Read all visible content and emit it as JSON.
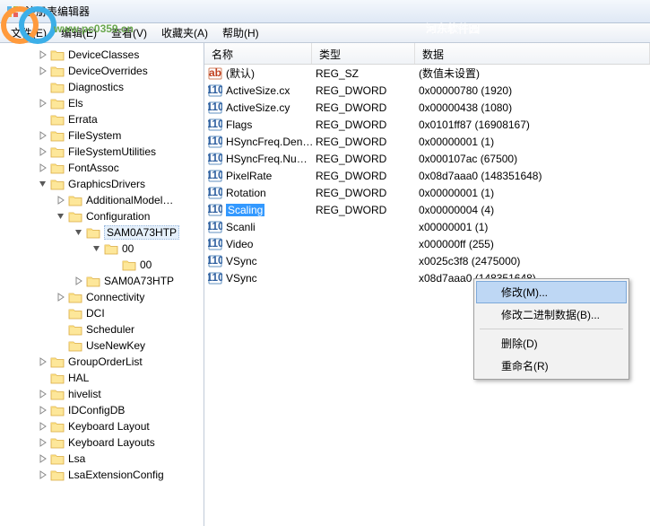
{
  "window": {
    "title": "注册表编辑器"
  },
  "menu": {
    "file": "文件(E)",
    "edit": "编辑(E)",
    "view": "查看(V)",
    "favorites": "收藏夹(A)",
    "help": "帮助(H)"
  },
  "watermark": {
    "url1": "www.pc0359.cn",
    "url2": "河东软件园"
  },
  "tree": [
    {
      "level": 1,
      "exp": "closed",
      "label": "DeviceClasses"
    },
    {
      "level": 1,
      "exp": "closed",
      "label": "DeviceOverrides"
    },
    {
      "level": 1,
      "exp": "none",
      "label": "Diagnostics"
    },
    {
      "level": 1,
      "exp": "closed",
      "label": "Els"
    },
    {
      "level": 1,
      "exp": "none",
      "label": "Errata"
    },
    {
      "level": 1,
      "exp": "closed",
      "label": "FileSystem"
    },
    {
      "level": 1,
      "exp": "closed",
      "label": "FileSystemUtilities"
    },
    {
      "level": 1,
      "exp": "closed",
      "label": "FontAssoc"
    },
    {
      "level": 1,
      "exp": "open",
      "label": "GraphicsDrivers"
    },
    {
      "level": 2,
      "exp": "closed",
      "label": "AdditionalModel…"
    },
    {
      "level": 2,
      "exp": "open",
      "label": "Configuration"
    },
    {
      "level": 3,
      "exp": "open",
      "label": "SAM0A73HTP",
      "highlight": true
    },
    {
      "level": 4,
      "exp": "open",
      "label": "00"
    },
    {
      "level": 5,
      "exp": "none",
      "label": "00"
    },
    {
      "level": 3,
      "exp": "closed",
      "label": "SAM0A73HTP"
    },
    {
      "level": 2,
      "exp": "closed",
      "label": "Connectivity"
    },
    {
      "level": 2,
      "exp": "none",
      "label": "DCI"
    },
    {
      "level": 2,
      "exp": "none",
      "label": "Scheduler"
    },
    {
      "level": 2,
      "exp": "none",
      "label": "UseNewKey"
    },
    {
      "level": 1,
      "exp": "closed",
      "label": "GroupOrderList"
    },
    {
      "level": 1,
      "exp": "none",
      "label": "HAL"
    },
    {
      "level": 1,
      "exp": "closed",
      "label": "hivelist"
    },
    {
      "level": 1,
      "exp": "closed",
      "label": "IDConfigDB"
    },
    {
      "level": 1,
      "exp": "closed",
      "label": "Keyboard Layout"
    },
    {
      "level": 1,
      "exp": "closed",
      "label": "Keyboard Layouts"
    },
    {
      "level": 1,
      "exp": "closed",
      "label": "Lsa"
    },
    {
      "level": 1,
      "exp": "closed",
      "label": "LsaExtensionConfig"
    }
  ],
  "columns": {
    "name": "名称",
    "type": "类型",
    "data": "数据"
  },
  "rows": [
    {
      "icon": "sz",
      "name": "(默认)",
      "type": "REG_SZ",
      "data": "(数值未设置)"
    },
    {
      "icon": "dw",
      "name": "ActiveSize.cx",
      "type": "REG_DWORD",
      "data": "0x00000780 (1920)"
    },
    {
      "icon": "dw",
      "name": "ActiveSize.cy",
      "type": "REG_DWORD",
      "data": "0x00000438 (1080)"
    },
    {
      "icon": "dw",
      "name": "Flags",
      "type": "REG_DWORD",
      "data": "0x0101ff87 (16908167)"
    },
    {
      "icon": "dw",
      "name": "HSyncFreq.Den…",
      "type": "REG_DWORD",
      "data": "0x00000001 (1)"
    },
    {
      "icon": "dw",
      "name": "HSyncFreq.Nu…",
      "type": "REG_DWORD",
      "data": "0x000107ac (67500)"
    },
    {
      "icon": "dw",
      "name": "PixelRate",
      "type": "REG_DWORD",
      "data": "0x08d7aaa0 (148351648)"
    },
    {
      "icon": "dw",
      "name": "Rotation",
      "type": "REG_DWORD",
      "data": "0x00000001 (1)"
    },
    {
      "icon": "dw",
      "name": "Scaling",
      "type": "REG_DWORD",
      "data": "0x00000004 (4)",
      "selected": true
    },
    {
      "icon": "dw",
      "name": "Scanli",
      "type": "",
      "data": "x00000001 (1)"
    },
    {
      "icon": "dw",
      "name": "Video",
      "type": "",
      "data": "x000000ff (255)"
    },
    {
      "icon": "dw",
      "name": "VSync",
      "type": "",
      "data": "x0025c3f8 (2475000)"
    },
    {
      "icon": "dw",
      "name": "VSync",
      "type": "",
      "data": "x08d7aaa0 (148351648)"
    }
  ],
  "contextMenu": {
    "modify": "修改(M)...",
    "modifyBinary": "修改二进制数据(B)...",
    "delete": "删除(D)",
    "rename": "重命名(R)"
  }
}
